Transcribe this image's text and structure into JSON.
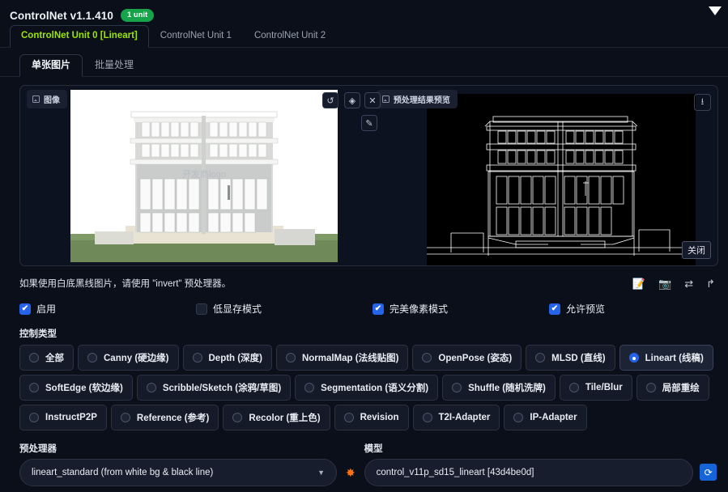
{
  "header": {
    "title": "ControlNet v1.1.410",
    "badge": "1 unit",
    "collapse_icon": "triangle-down-icon"
  },
  "unit_tabs": [
    {
      "label": "ControlNet Unit 0 [Lineart]",
      "active": true
    },
    {
      "label": "ControlNet Unit 1",
      "active": false
    },
    {
      "label": "ControlNet Unit 2",
      "active": false
    }
  ],
  "mode_tabs": [
    {
      "label": "单张图片",
      "active": true
    },
    {
      "label": "批量处理",
      "active": false
    }
  ],
  "image_panel": {
    "source_label": "图像",
    "preview_label": "预处理结果预览",
    "close_label": "关闭",
    "tools": [
      {
        "name": "undo-icon",
        "glyph": "↺"
      },
      {
        "name": "eraser-icon",
        "glyph": "◈"
      },
      {
        "name": "close-icon",
        "glyph": "✕"
      },
      {
        "name": "brush-icon",
        "glyph": "✎"
      }
    ],
    "download_icon": "download-icon"
  },
  "hint": {
    "text": "如果使用白底黑线图片，请使用 \"invert\" 预处理器。",
    "icons": [
      {
        "name": "note-edit-icon",
        "glyph": "📝"
      },
      {
        "name": "camera-icon",
        "glyph": "📷"
      },
      {
        "name": "swap-icon",
        "glyph": "⇄"
      },
      {
        "name": "arrow-return-icon",
        "glyph": "↱"
      }
    ]
  },
  "checkboxes": [
    {
      "label": "启用",
      "checked": true
    },
    {
      "label": "低显存模式",
      "checked": false
    },
    {
      "label": "完美像素模式",
      "checked": true
    },
    {
      "label": "允许预览",
      "checked": true
    }
  ],
  "control_type": {
    "label": "控制类型",
    "rows": [
      [
        {
          "label": "全部",
          "selected": false
        },
        {
          "label": "Canny (硬边缘)",
          "selected": false
        },
        {
          "label": "Depth (深度)",
          "selected": false
        },
        {
          "label": "NormalMap (法线贴图)",
          "selected": false
        },
        {
          "label": "OpenPose (姿态)",
          "selected": false
        },
        {
          "label": "MLSD (直线)",
          "selected": false
        },
        {
          "label": "Lineart (线稿)",
          "selected": true
        }
      ],
      [
        {
          "label": "SoftEdge (软边缘)",
          "selected": false
        },
        {
          "label": "Scribble/Sketch (涂鸦/草图)",
          "selected": false
        },
        {
          "label": "Segmentation (语义分割)",
          "selected": false
        },
        {
          "label": "Shuffle (随机洗牌)",
          "selected": false
        },
        {
          "label": "Tile/Blur",
          "selected": false
        },
        {
          "label": "局部重绘",
          "selected": false
        }
      ],
      [
        {
          "label": "InstructP2P",
          "selected": false
        },
        {
          "label": "Reference (参考)",
          "selected": false
        },
        {
          "label": "Recolor (重上色)",
          "selected": false
        },
        {
          "label": "Revision",
          "selected": false
        },
        {
          "label": "T2I-Adapter",
          "selected": false
        },
        {
          "label": "IP-Adapter",
          "selected": false
        }
      ]
    ]
  },
  "preprocessor": {
    "label": "预处理器",
    "value": "lineart_standard (from white bg & black line)",
    "chevron": "▼",
    "star_icon": "star-burst-icon"
  },
  "model": {
    "label": "模型",
    "value": "control_v11p_sd15_lineart [43d4be0d]",
    "refresh_icon": "refresh-icon"
  },
  "colors": {
    "accent_green": "#9ae600",
    "badge_green": "#16a34a",
    "accent_blue": "#2563eb",
    "background": "#0b0f19"
  }
}
